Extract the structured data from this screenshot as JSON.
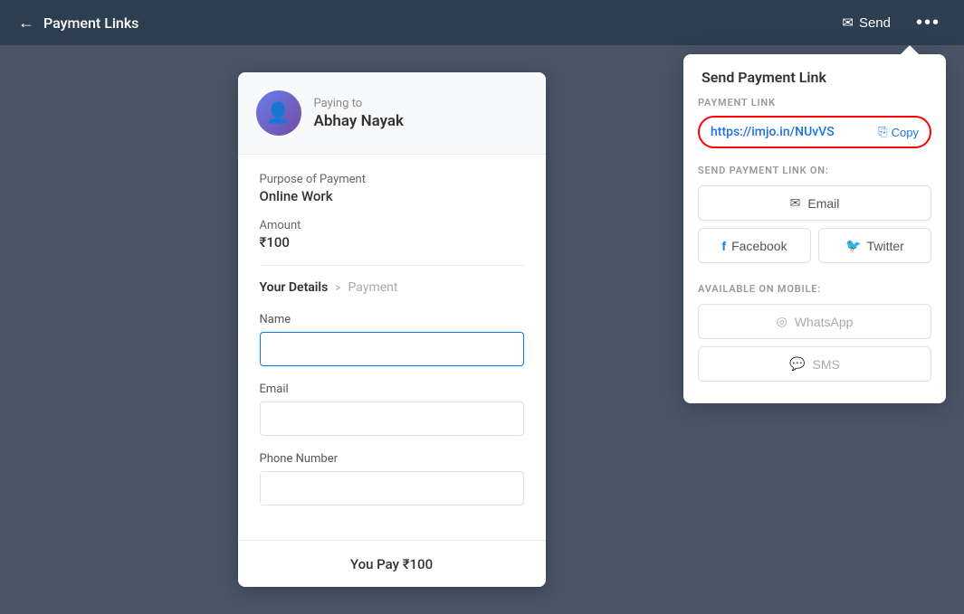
{
  "header": {
    "back_label": "Payment Links",
    "send_label": "Send",
    "more_icon": "•••"
  },
  "payment_card": {
    "paying_to_label": "Paying to",
    "paying_to_name": "Abhay Nayak",
    "purpose_label": "Purpose of Payment",
    "purpose_value": "Online Work",
    "amount_label": "Amount",
    "amount_value": "₹100",
    "breadcrumb_active": "Your Details",
    "breadcrumb_separator": ">",
    "breadcrumb_inactive": "Payment",
    "name_label": "Name",
    "name_placeholder": "",
    "email_label": "Email",
    "email_placeholder": "",
    "phone_label": "Phone Number",
    "phone_placeholder": "",
    "footer_text": "You Pay ₹100"
  },
  "send_panel": {
    "title": "Send Payment Link",
    "payment_link_label": "PAYMENT LINK",
    "payment_link_url": "https://imjo.in/NUvVS",
    "copy_label": "Copy",
    "send_on_label": "SEND PAYMENT LINK ON:",
    "email_btn": "Email",
    "facebook_btn": "Facebook",
    "twitter_btn": "Twitter",
    "available_mobile_label": "AVAILABLE ON MOBILE:",
    "whatsapp_btn": "WhatsApp",
    "sms_btn": "SMS"
  }
}
